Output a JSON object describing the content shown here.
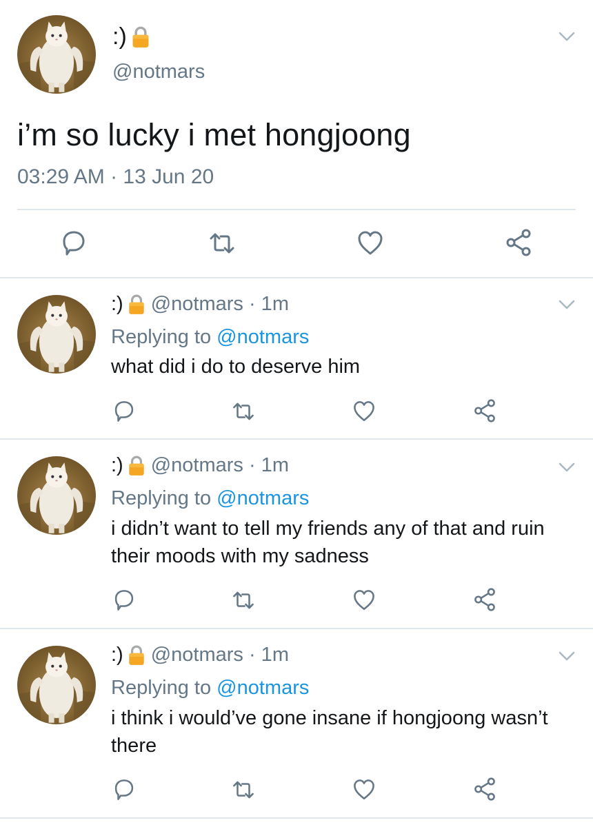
{
  "main_tweet": {
    "display_name": ":)",
    "handle": "@notmars",
    "text": "i’m so lucky i met hongjoong",
    "timestamp": "03:29 AM · 13 Jun 20"
  },
  "replies": [
    {
      "display_name": ":)",
      "handle_time": "@notmars · 1m",
      "replying_prefix": "Replying to ",
      "replying_to": "@notmars",
      "text": "what did i do to deserve him"
    },
    {
      "display_name": ":)",
      "handle_time": "@notmars · 1m",
      "replying_prefix": "Replying to ",
      "replying_to": "@notmars",
      "text": "i didn’t want to tell my friends any of that and ruin their moods with my sadness"
    },
    {
      "display_name": ":)",
      "handle_time": "@notmars · 1m",
      "replying_prefix": "Replying to ",
      "replying_to": "@notmars",
      "text": "i think i would’ve gone insane if hongjoong wasn’t there"
    }
  ],
  "icons": {
    "lock": "lock-icon",
    "reply": "reply-icon",
    "retweet": "retweet-icon",
    "like": "heart-icon",
    "share": "share-icon",
    "menu": "chevron-down-icon"
  },
  "colors": {
    "text": "#14171a",
    "secondary": "#657786",
    "link": "#1b95e0",
    "lock": "#f5a623",
    "divider": "#e1e8ed"
  }
}
